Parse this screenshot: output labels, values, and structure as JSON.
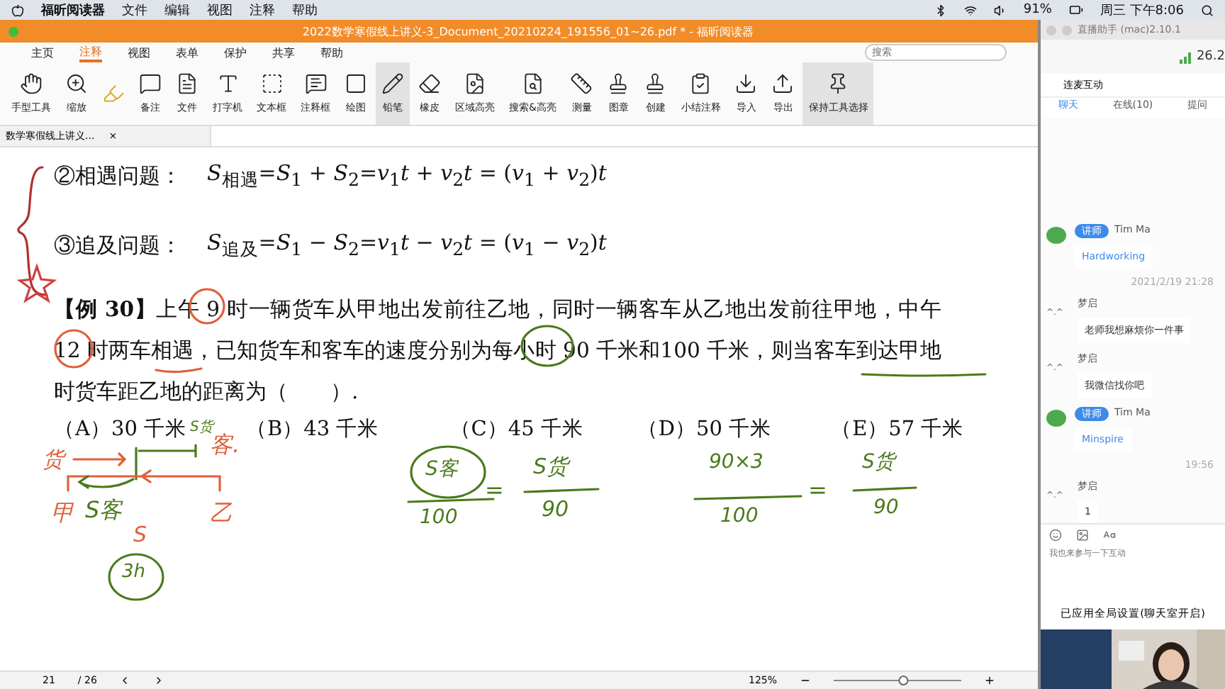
{
  "menu_bar": {
    "app": "福昕阅读器",
    "items": [
      "文件",
      "编辑",
      "视图",
      "注释",
      "帮助"
    ],
    "battery": "91%",
    "clock": "周三 下午8:06"
  },
  "window": {
    "title": "2022数学寒假线上讲义-3_Document_20210224_191556_01~26.pdf * - 福昕阅读器"
  },
  "ribbon_tabs": [
    {
      "label": "主页",
      "selected": false
    },
    {
      "label": "注释",
      "selected": true
    },
    {
      "label": "视图",
      "selected": false
    },
    {
      "label": "表单",
      "selected": false
    },
    {
      "label": "保护",
      "selected": false
    },
    {
      "label": "共享",
      "selected": false
    },
    {
      "label": "帮助",
      "selected": false
    }
  ],
  "search": {
    "placeholder": "搜索"
  },
  "tools": [
    {
      "label": "手型工具",
      "selected": false
    },
    {
      "label": "缩放",
      "selected": false
    },
    {
      "label": "备注",
      "selected": false
    },
    {
      "label": "文件",
      "selected": false
    },
    {
      "label": "打字机",
      "selected": false
    },
    {
      "label": "文本框",
      "selected": false
    },
    {
      "label": "注释框",
      "selected": false
    },
    {
      "label": "绘图",
      "selected": false
    },
    {
      "label": "铅笔",
      "selected": true
    },
    {
      "label": "橡皮",
      "selected": false
    },
    {
      "label": "区域高亮",
      "selected": false
    },
    {
      "label": "搜索&高亮",
      "selected": false
    },
    {
      "label": "测量",
      "selected": false
    },
    {
      "label": "图章",
      "selected": false
    },
    {
      "label": "创建",
      "selected": false
    },
    {
      "label": "小结注释",
      "selected": false
    },
    {
      "label": "导入",
      "selected": false
    },
    {
      "label": "导出",
      "selected": false
    },
    {
      "label": "保持工具选择",
      "selected": true
    }
  ],
  "doc_tab": {
    "label": "数学寒假线上讲义...",
    "close": "×"
  },
  "document": {
    "formulas": [
      {
        "label": "②相遇问题：",
        "formula": "*S*$_{相遇}$=*S*$_{1}$ + *S*$_{2}$=*v*$_{1}$*t* + *v*$_{2}$*t* = (*v*$_{1}$ + *v*$_{2}$)*t*"
      },
      {
        "label": "③追及问题：",
        "formula": "*S*$_{追及}$=*S*$_{1}$ − *S*$_{2}$=*v*$_{1}$*t* − *v*$_{2}$*t* = (*v*$_{1}$ − *v*$_{2}$)*t*"
      }
    ],
    "problem": "**【例 30】**上午 9 时一辆货车从甲地出发前往乙地，同时一辆客车从乙地出发前往甲地，中午 12 时两车相遇，已知货车和客车的速度分别为每小时 90 千米和100 千米，则当客车到达甲地时货车距乙地的距离为（　　）.",
    "options": [
      "（A）30 千米",
      "（B）43 千米",
      "（C）45 千米",
      "（D）50 千米",
      "（E）57 千米"
    ],
    "annotations": [
      {
        "text": "货",
        "color": "#e0603a"
      },
      {
        "text": "客.",
        "color": "#e0603a"
      },
      {
        "text": "S货",
        "color": "#4a7a1c"
      },
      {
        "text": "甲",
        "color": "#e0603a"
      },
      {
        "text": "S客",
        "color": "#4a7a1c"
      },
      {
        "text": "乙",
        "color": "#e0603a"
      },
      {
        "text": "S",
        "color": "#e0603a"
      },
      {
        "text": "3h",
        "color": "#4a7a1c"
      },
      {
        "text": "S客",
        "color": "#4a7a1c"
      },
      {
        "text": "100",
        "color": "#4a7a1c"
      },
      {
        "text": "=",
        "color": "#4a7a1c"
      },
      {
        "text": "S货",
        "color": "#4a7a1c"
      },
      {
        "text": "90",
        "color": "#4a7a1c"
      },
      {
        "text": "90×3",
        "color": "#4a7a1c"
      },
      {
        "text": "100",
        "color": "#4a7a1c"
      },
      {
        "text": "=",
        "color": "#4a7a1c"
      },
      {
        "text": "S货",
        "color": "#4a7a1c"
      },
      {
        "text": "90",
        "color": "#4a7a1c"
      }
    ]
  },
  "status_bar": {
    "page": "21",
    "total": "/ 26",
    "zoom": "125%",
    "zoom_slider": {
      "level": 0.55
    }
  },
  "live_panel": {
    "title": "直播助手 (mac)2.10.1",
    "signal": "26.2",
    "section": "连麦互动",
    "tabs": [
      {
        "label": "聊天",
        "selected": true
      },
      {
        "label": "在线(10)",
        "selected": false
      },
      {
        "label": "提问",
        "selected": false
      }
    ],
    "messages": [
      {
        "kind": "teacher",
        "badge": "讲师",
        "name": "Tim Ma",
        "text": "Hardworking"
      },
      {
        "kind": "time",
        "text": "2021/2/19 21:28"
      },
      {
        "kind": "student",
        "avatar": "^.^",
        "name": "梦启",
        "text": "老师我想麻烦你一件事"
      },
      {
        "kind": "student",
        "avatar": "^.^",
        "name": "梦启",
        "text": "我微信找你吧"
      },
      {
        "kind": "teacher",
        "badge": "讲师",
        "name": "Tim Ma",
        "text": "Minspire"
      },
      {
        "kind": "time",
        "text": "19:56"
      },
      {
        "kind": "student",
        "avatar": "^.^",
        "name": "梦启",
        "text": "1"
      }
    ],
    "input": {
      "placeholder": "我也来参与一下互动"
    },
    "notice": "已应用全局设置(聊天室开启)"
  }
}
